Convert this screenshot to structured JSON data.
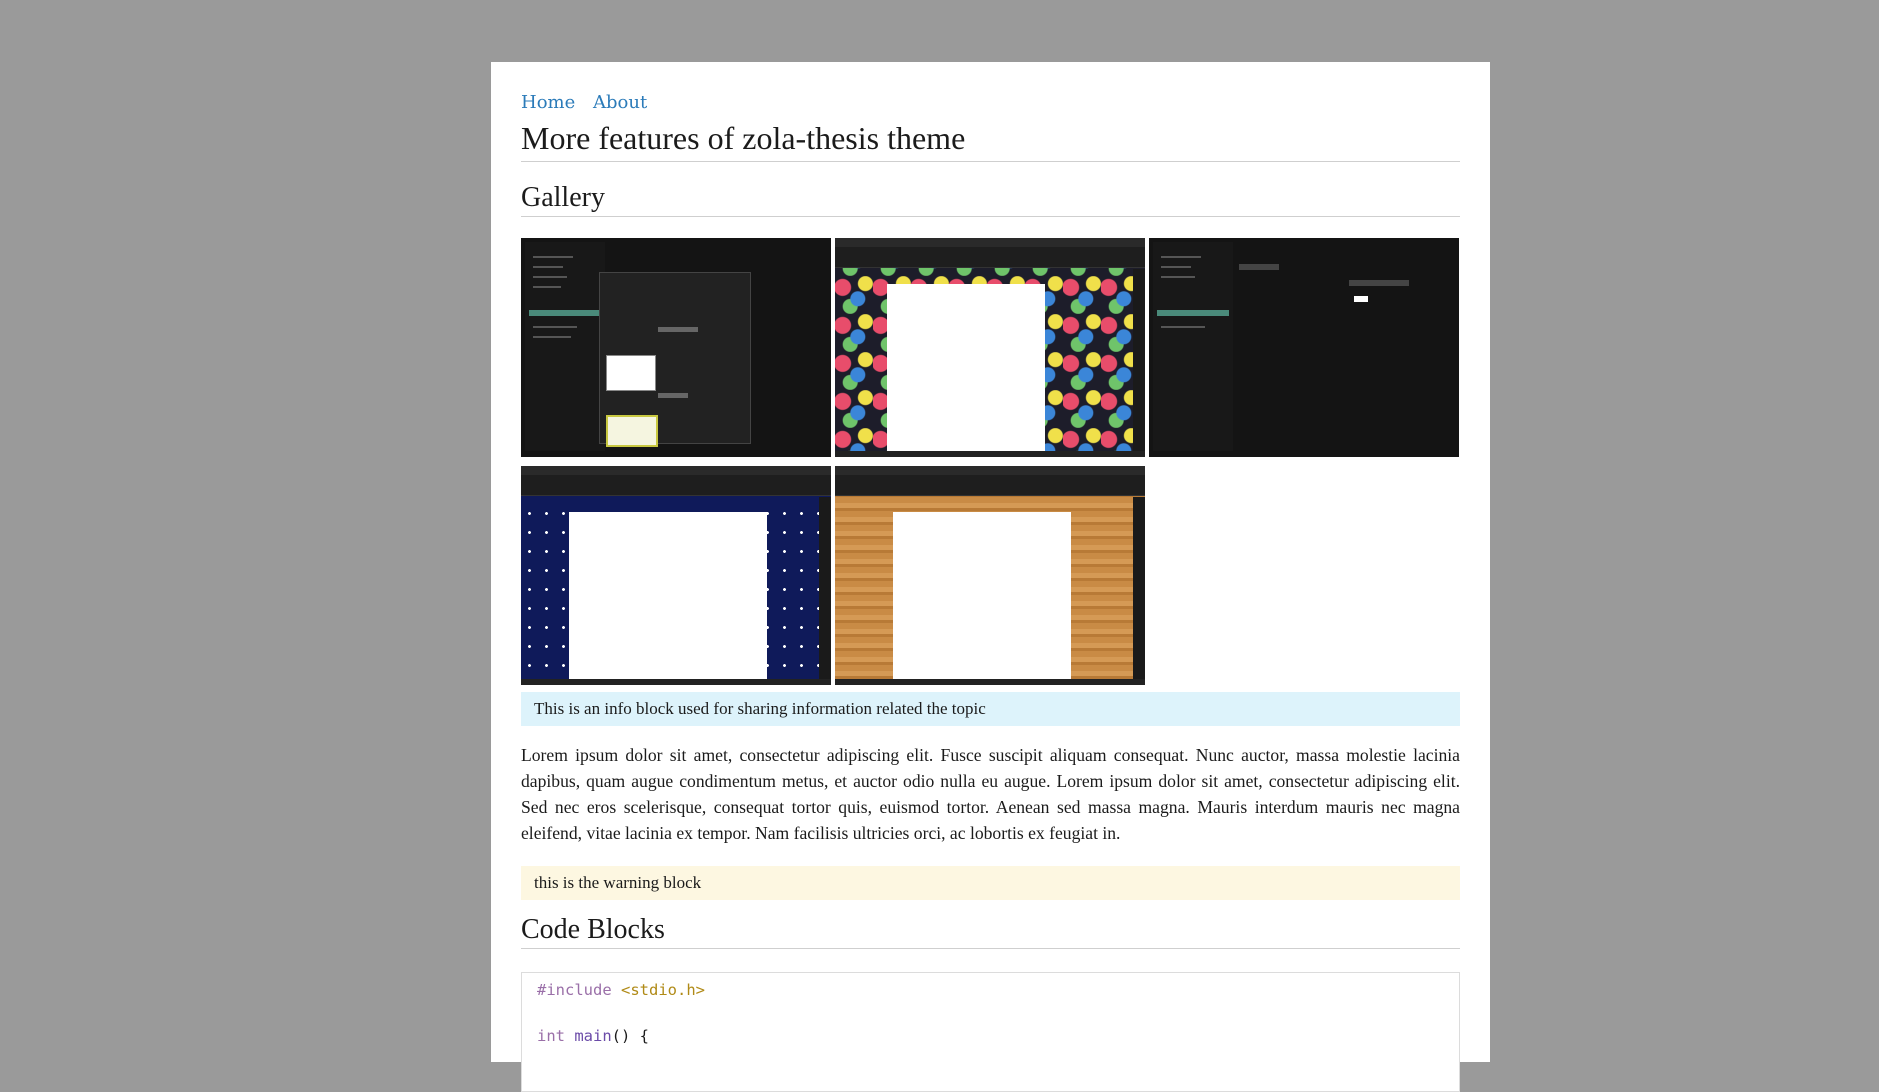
{
  "nav": {
    "home": "Home",
    "about": "About"
  },
  "title": "More features of zola-thesis theme",
  "gallery": {
    "heading": "Gallery",
    "images": [
      {
        "name": "libreoffice-themes-dialog"
      },
      {
        "name": "writer-flowers-theme"
      },
      {
        "name": "libreoffice-options-dark"
      },
      {
        "name": "writer-stars-theme"
      },
      {
        "name": "writer-wood-theme"
      }
    ]
  },
  "info_block": "This is an info block used for sharing information related the topic",
  "paragraph": "Lorem ipsum dolor sit amet, consectetur adipiscing elit. Fusce suscipit aliquam consequat. Nunc auctor, massa molestie lacinia dapibus, quam augue condimentum metus, et auctor odio nulla eu augue. Lorem ipsum dolor sit amet, consectetur adipiscing elit. Sed nec eros scelerisque, consequat tortor quis, euismod tortor. Aenean sed massa magna. Mauris interdum mauris nec magna eleifend, vitae lacinia ex tempor. Nam facilisis ultricies orci, ac lobortis ex feugiat in.",
  "warning_block": "this is the warning block",
  "code_section": {
    "heading": "Code Blocks",
    "line1_directive": "#include",
    "line1_header": "<stdio.h>",
    "line3_type": "int",
    "line3_fn": "main",
    "line3_rest": "() {"
  },
  "colors": {
    "page_bg": "#9a9a9a",
    "link": "#2b7bb9",
    "info_bg": "#ddf3fb",
    "warning_bg": "#fdf7e1"
  }
}
